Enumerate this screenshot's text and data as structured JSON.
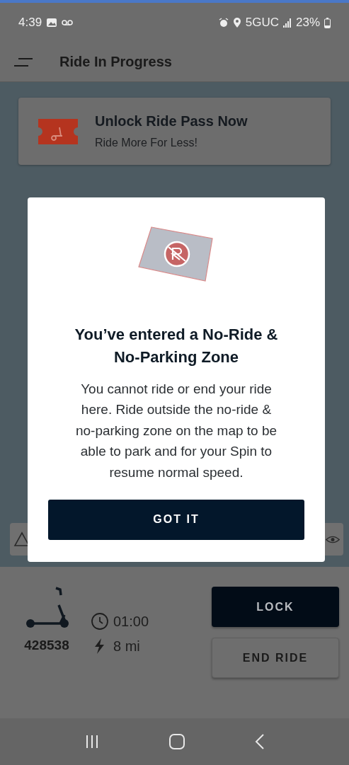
{
  "status_bar": {
    "time": "4:39",
    "network": "5GUC",
    "battery": "23%"
  },
  "header": {
    "title": "Ride In Progress"
  },
  "promo": {
    "title": "Unlock Ride Pass Now",
    "subtitle": "Ride More For Less!"
  },
  "dialog": {
    "title": "You’ve entered a No-Ride & No-Parking Zone",
    "message": "You cannot ride or end your ride here. Ride outside the no-ride & no-parking zone on the map to be able to park and for your Spin to resume normal speed.",
    "button": "GOT IT"
  },
  "ride": {
    "vehicle_id": "428538",
    "duration": "01:00",
    "range": "8 mi"
  },
  "actions": [
    {
      "label": "LOCK",
      "kind": "primary"
    },
    {
      "label": "END RIDE",
      "kind": "secondary"
    }
  ]
}
